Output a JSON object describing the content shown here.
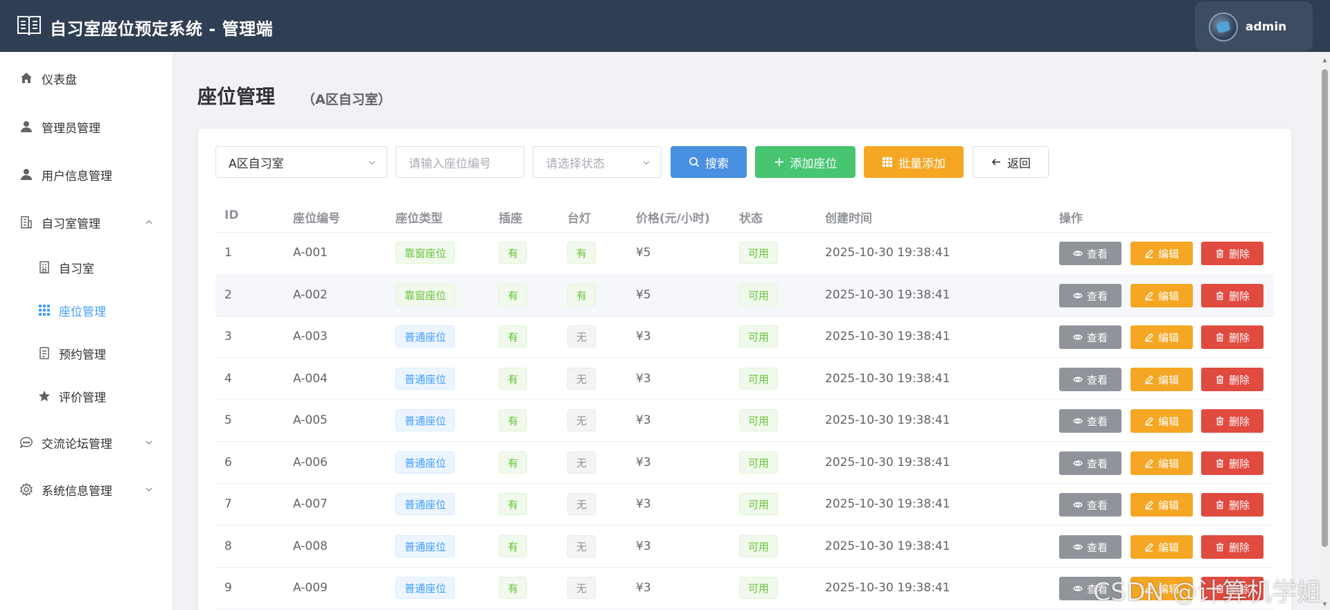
{
  "header": {
    "title": "自习室座位预定系统 - 管理端",
    "username": "admin"
  },
  "sidebar": {
    "items": [
      {
        "label": "仪表盘",
        "icon": "home-icon"
      },
      {
        "label": "管理员管理",
        "icon": "user-icon"
      },
      {
        "label": "用户信息管理",
        "icon": "user-icon"
      },
      {
        "label": "自习室管理",
        "icon": "building-icon",
        "expanded": true
      },
      {
        "label": "自习室",
        "icon": "building-icon"
      },
      {
        "label": "座位管理",
        "icon": "grid-icon",
        "active": true
      },
      {
        "label": "预约管理",
        "icon": "document-icon"
      },
      {
        "label": "评价管理",
        "icon": "star-icon"
      },
      {
        "label": "交流论坛管理",
        "icon": "chat-icon"
      },
      {
        "label": "系统信息管理",
        "icon": "gear-icon"
      }
    ]
  },
  "page": {
    "title": "座位管理",
    "subtitle": "（A区自习室）"
  },
  "filters": {
    "room_value": "A区自习室",
    "seat_placeholder": "请输入座位编号",
    "status_placeholder": "请选择状态",
    "search_label": "搜索",
    "add_label": "添加座位",
    "batch_label": "批量添加",
    "back_label": "返回"
  },
  "table": {
    "headers": [
      "ID",
      "座位编号",
      "座位类型",
      "插座",
      "台灯",
      "价格(元/小时)",
      "状态",
      "创建时间",
      "操作"
    ],
    "action_labels": {
      "view": "查看",
      "edit": "编辑",
      "delete": "删除"
    },
    "rows": [
      {
        "id": "1",
        "code": "A-001",
        "type": "靠窗座位",
        "type_kind": "window",
        "socket": "有",
        "lamp": "有",
        "price": "¥5",
        "status": "可用",
        "created": "2025-10-30 19:38:41"
      },
      {
        "id": "2",
        "code": "A-002",
        "type": "靠窗座位",
        "type_kind": "window",
        "socket": "有",
        "lamp": "有",
        "price": "¥5",
        "status": "可用",
        "created": "2025-10-30 19:38:41"
      },
      {
        "id": "3",
        "code": "A-003",
        "type": "普通座位",
        "type_kind": "normal",
        "socket": "有",
        "lamp": "无",
        "price": "¥3",
        "status": "可用",
        "created": "2025-10-30 19:38:41"
      },
      {
        "id": "4",
        "code": "A-004",
        "type": "普通座位",
        "type_kind": "normal",
        "socket": "有",
        "lamp": "无",
        "price": "¥3",
        "status": "可用",
        "created": "2025-10-30 19:38:41"
      },
      {
        "id": "5",
        "code": "A-005",
        "type": "普通座位",
        "type_kind": "normal",
        "socket": "有",
        "lamp": "无",
        "price": "¥3",
        "status": "可用",
        "created": "2025-10-30 19:38:41"
      },
      {
        "id": "6",
        "code": "A-006",
        "type": "普通座位",
        "type_kind": "normal",
        "socket": "有",
        "lamp": "无",
        "price": "¥3",
        "status": "可用",
        "created": "2025-10-30 19:38:41"
      },
      {
        "id": "7",
        "code": "A-007",
        "type": "普通座位",
        "type_kind": "normal",
        "socket": "有",
        "lamp": "无",
        "price": "¥3",
        "status": "可用",
        "created": "2025-10-30 19:38:41"
      },
      {
        "id": "8",
        "code": "A-008",
        "type": "普通座位",
        "type_kind": "normal",
        "socket": "有",
        "lamp": "无",
        "price": "¥3",
        "status": "可用",
        "created": "2025-10-30 19:38:41"
      },
      {
        "id": "9",
        "code": "A-009",
        "type": "普通座位",
        "type_kind": "normal",
        "socket": "有",
        "lamp": "无",
        "price": "¥3",
        "status": "可用",
        "created": "2025-10-30 19:38:41"
      }
    ]
  },
  "watermark": "CSDN @计算机学姐",
  "colors": {
    "header_bg": "#2f3e52",
    "primary": "#4a90e2",
    "success": "#47c571",
    "warning": "#f5a623",
    "danger": "#e04a3f",
    "info": "#909399"
  }
}
